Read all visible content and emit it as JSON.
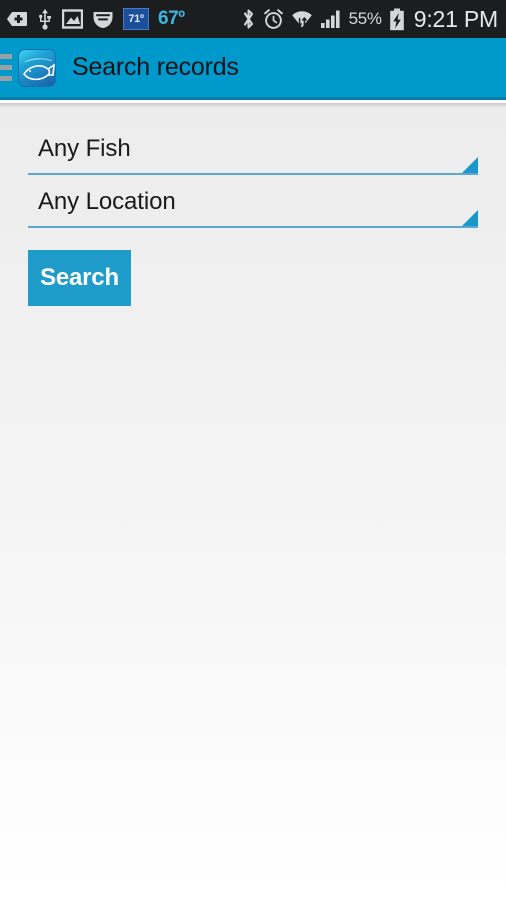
{
  "status_bar": {
    "left_icons": [
      {
        "name": "add-tag-icon",
        "label": "+"
      },
      {
        "name": "usb-icon",
        "label": "USB"
      },
      {
        "name": "screenshot-image-icon",
        "label": "Image"
      },
      {
        "name": "vpn-shield-icon",
        "label": "Shield"
      }
    ],
    "weather": {
      "badge_temp": "71º",
      "outdoor_temp": "67º"
    },
    "right_icons": [
      {
        "name": "alarm-clock-icon",
        "label": "Alarm"
      },
      {
        "name": "wifi-icon",
        "label": "Wi-Fi"
      },
      {
        "name": "cellular-signal-icon",
        "label": "Signal"
      }
    ],
    "battery_percent": "55%",
    "battery_state": "charging",
    "clock": "9:21 PM",
    "background_color": "#1b1d1f"
  },
  "app_bar": {
    "menu_label": "Navigation drawer",
    "app_icon_name": "fish-app-icon",
    "title": "Search records",
    "background_color": "#0099cc",
    "title_color": "#111418"
  },
  "form": {
    "fish_spinner": {
      "value": "Any Fish",
      "placeholder": "Any Fish"
    },
    "location_spinner": {
      "value": "Any Location",
      "placeholder": "Any Location"
    },
    "search_button": {
      "label": "Search",
      "background_color": "#1f9cc9",
      "text_color": "#ffffff"
    },
    "underline_color": "#5aa8cf",
    "arrow_color": "#1b98c9"
  },
  "theme": {
    "accent": "#0099cc",
    "content_background_top": "#ececec",
    "content_background_bottom": "#ffffff"
  }
}
